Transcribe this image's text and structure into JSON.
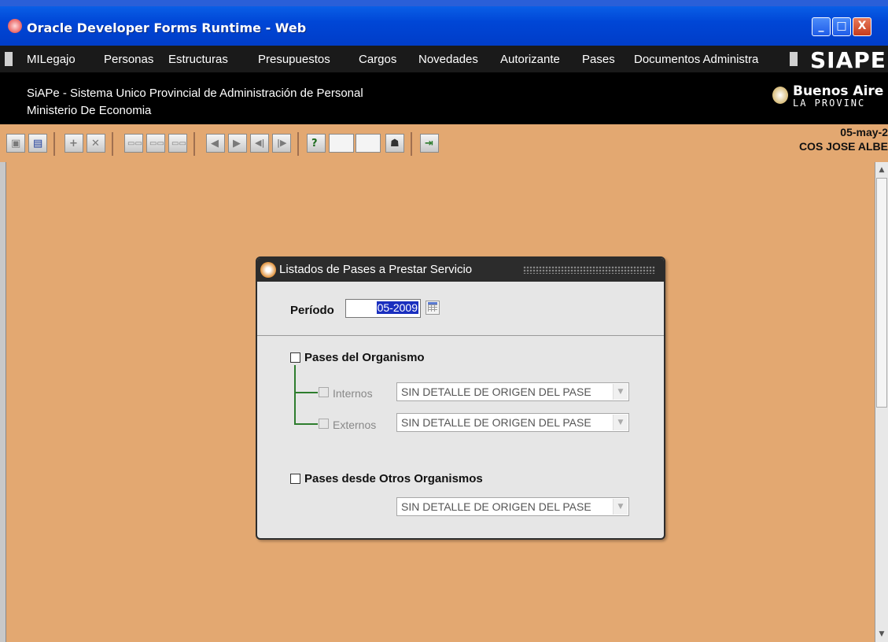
{
  "window": {
    "title": "Oracle Developer Forms Runtime - Web",
    "minimize": "_",
    "maximize": "□",
    "close": "X"
  },
  "menu": {
    "items": [
      "MILegajo",
      "Personas",
      "Estructuras",
      "Presupuestos",
      "Cargos",
      "Novedades",
      "Autorizante",
      "Pases",
      "Documentos Administra"
    ],
    "logo": "SIAPE"
  },
  "header": {
    "line1": "SiAPe - Sistema Unico Provincial de Administración de Personal",
    "line2": "Ministerio De Economia",
    "logo_name": "Buenos Aire",
    "logo_sub": "LA PROVINC"
  },
  "toolbar": {
    "date": "05-may-2",
    "user": "COS JOSE ALBE",
    "help": "?"
  },
  "dialog": {
    "title": "Listados de Pases a Prestar Servicio",
    "periodo_label": "Período",
    "periodo_value": "05-2009",
    "pases_organismo_label": "Pases del Organismo",
    "internos_label": "Internos",
    "internos_combo": "SIN DETALLE DE ORIGEN DEL PASE",
    "externos_label": "Externos",
    "externos_combo": "SIN DETALLE DE ORIGEN DEL PASE",
    "otros_label": "Pases desde Otros Organismos",
    "otros_combo": "SIN DETALLE DE ORIGEN DEL PASE"
  }
}
